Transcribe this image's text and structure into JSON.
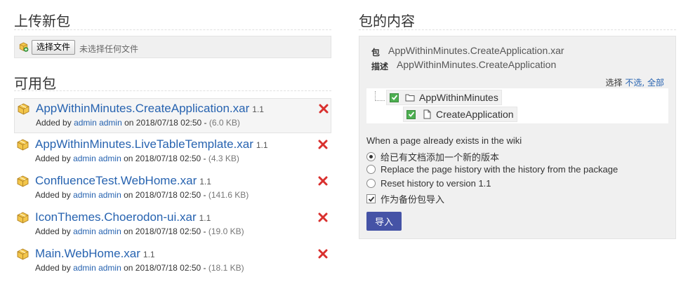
{
  "upload": {
    "title": "上传新包",
    "choose_button": "选择文件",
    "file_status": "未选择任何文件"
  },
  "available": {
    "title": "可用包",
    "packages": [
      {
        "name": "AppWithinMinutes.CreateApplication.xar",
        "version": "1.1",
        "added_by_prefix": "Added by",
        "author": "admin admin",
        "date_prefix": "on 2018/07/18 02:50 -",
        "size": "(6.0 KB)",
        "selected": true
      },
      {
        "name": "AppWithinMinutes.LiveTableTemplate.xar",
        "version": "1.1",
        "added_by_prefix": "Added by",
        "author": "admin admin",
        "date_prefix": "on 2018/07/18 02:50 -",
        "size": "(4.3 KB)",
        "selected": false
      },
      {
        "name": "ConfluenceTest.WebHome.xar",
        "version": "1.1",
        "added_by_prefix": "Added by",
        "author": "admin admin",
        "date_prefix": "on 2018/07/18 02:50 -",
        "size": "(141.6 KB)",
        "selected": false
      },
      {
        "name": "IconThemes.Choerodon-ui.xar",
        "version": "1.1",
        "added_by_prefix": "Added by",
        "author": "admin admin",
        "date_prefix": "on 2018/07/18 02:50 -",
        "size": "(19.0 KB)",
        "selected": false
      },
      {
        "name": "Main.WebHome.xar",
        "version": "1.1",
        "added_by_prefix": "Added by",
        "author": "admin admin",
        "date_prefix": "on 2018/07/18 02:50 -",
        "size": "(18.1 KB)",
        "selected": false
      }
    ]
  },
  "contents": {
    "title": "包的内容",
    "package_label": "包",
    "package_value": "AppWithinMinutes.CreateApplication.xar",
    "description_label": "描述",
    "description_value": "AppWithinMinutes.CreateApplication",
    "select_prefix": "选择",
    "select_none": "不选,",
    "select_all": "全部",
    "tree": {
      "space_label": "AppWithinMinutes",
      "page_label": "CreateApplication"
    },
    "existing_question": "When a page already exists in the wiki",
    "options": [
      {
        "label": "给已有文档添加一个新的版本",
        "checked": true
      },
      {
        "label": "Replace the page history with the history from the package",
        "checked": false
      },
      {
        "label": "Reset history to version 1.1",
        "checked": false
      }
    ],
    "backup_label": "作为备份包导入",
    "backup_checked": true,
    "import_button": "导入"
  },
  "colors": {
    "link": "#2763b0",
    "delete": "#d9302e",
    "checkbox_green": "#4caf50",
    "import_button": "#4553a6",
    "panel_bg": "#f0f0f0"
  },
  "icons": [
    "package-icon",
    "upload-package-icon",
    "delete-icon",
    "folder-icon",
    "page-icon",
    "check-icon"
  ]
}
